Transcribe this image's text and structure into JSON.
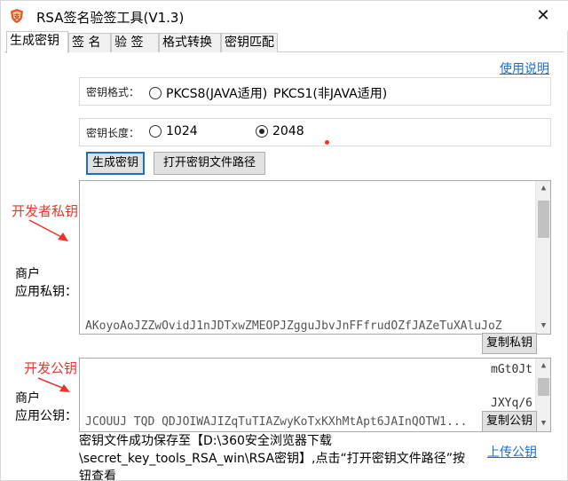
{
  "window": {
    "title": "RSA签名验签工具(V1.3)",
    "close_glyph": "✕",
    "app_icon": "shield-logo-icon"
  },
  "tabs": [
    {
      "label": "生成密钥",
      "active": true
    },
    {
      "label": "签 名",
      "active": false
    },
    {
      "label": "验 签",
      "active": false
    },
    {
      "label": "格式转换",
      "active": false
    },
    {
      "label": "密钥匹配",
      "active": false
    }
  ],
  "help_link": "使用说明",
  "key_format": {
    "label": "密钥格式：",
    "options": [
      {
        "label": "PKCS8(JAVA适用)",
        "checked": false
      },
      {
        "label": "PKCS1(非JAVA适用)",
        "checked": false
      }
    ]
  },
  "key_length": {
    "label": "密钥长度：",
    "options": [
      {
        "label": "1024",
        "checked": false
      },
      {
        "label": "2048",
        "checked": true
      }
    ]
  },
  "buttons": {
    "generate": "生成密钥",
    "open_path": "打开密钥文件路径",
    "copy_private": "复制私钥",
    "copy_public": "复制公钥"
  },
  "private_key": {
    "label_line1": "商户",
    "label_line2": "应用私钥：",
    "visible_tail": "AKoyoAoJZZwOvidJ1nJDTxwZMEOPJZgguJbvJnFFfrudOZfJAZeTuXAluJoZ"
  },
  "public_key": {
    "label_line1": "商户",
    "label_line2": "应用公钥：",
    "fragment_1": "mGt0Jt",
    "fragment_2": "JXYq/6",
    "bottom_line": "JCOUUJ TQD QDJOIWAJIZqTuTIAZwyKoTxKXhMtApt6JAInQOTW1..."
  },
  "annotations": {
    "dev_private": "开发者私钥",
    "dev_public": "开发公钥"
  },
  "status": {
    "line1": "密钥文件成功保存至【D:\\360安全浏览器下载",
    "line2": "\\secret_key_tools_RSA_win\\RSA密钥】,点击“打开密钥文件路径”按",
    "line3": "钮查看"
  },
  "upload_link": "上传公钥",
  "colors": {
    "link": "#1a6fc8",
    "annotation": "#e8362f",
    "focus": "#1a6fc8"
  }
}
